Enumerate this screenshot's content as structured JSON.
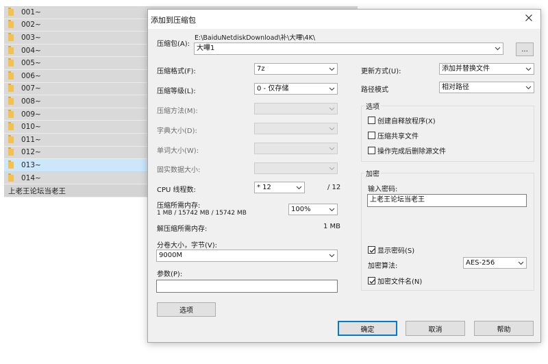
{
  "file_list": {
    "rows": [
      {
        "name": "001~"
      },
      {
        "name": "002~"
      },
      {
        "name": "003~"
      },
      {
        "name": "004~"
      },
      {
        "name": "005~"
      },
      {
        "name": "006~"
      },
      {
        "name": "007~"
      },
      {
        "name": "008~"
      },
      {
        "name": "009~"
      },
      {
        "name": "010~"
      },
      {
        "name": "011~"
      },
      {
        "name": "012~"
      },
      {
        "name": "013~"
      },
      {
        "name": "014~"
      }
    ],
    "selected_row": "013~",
    "extra_row": "上老王论坛当老王"
  },
  "dialog": {
    "title": "添加到压缩包",
    "close_icon": "close-icon",
    "archive": {
      "label": "压缩包(A):",
      "path": "E:\\BaiduNetdiskDownload\\补\\大嗶\\4K\\",
      "name_value": "大嗶1",
      "browse_label": "..."
    },
    "left": {
      "format_label": "压缩格式(F):",
      "format_value": "7z",
      "level_label": "压缩等级(L):",
      "level_value": "0 - 仅存储",
      "method_label": "压缩方法(M):",
      "dict_label": "字典大小(D):",
      "word_label": "单词大小(W):",
      "solid_label": "固实数据大小:",
      "cpu_label": "CPU 线程数:",
      "cpu_value": "* 12",
      "cpu_total": "/ 12",
      "mem_label": "压缩所需内存:",
      "mem_detail": "1 MB / 15742 MB / 15742 MB",
      "mem_percent": "100%",
      "decomp_label": "解压缩所需内存:",
      "decomp_value": "1 MB",
      "volume_label": "分卷大小，字节(V):",
      "volume_value": "9000M",
      "params_label": "参数(P):",
      "params_value": "",
      "options_button": "选项"
    },
    "right": {
      "update_label": "更新方式(U):",
      "update_value": "添加并替换文件",
      "path_label": "路径模式",
      "path_value": "相对路径",
      "options_group": "选项",
      "opt_sfx": "创建自释放程序(X)",
      "opt_shared": "压缩共享文件",
      "opt_delete": "操作完成后删除源文件",
      "encrypt_group": "加密",
      "password_label": "输入密码:",
      "password_value": "上老王论坛当老王",
      "show_password": "显示密码(S)",
      "method_label": "加密算法:",
      "method_value": "AES-256",
      "encrypt_names": "加密文件名(N)"
    },
    "checkbox_states": {
      "sfx": false,
      "shared": false,
      "delete": false,
      "show_password": true,
      "encrypt_names": true
    },
    "footer": {
      "ok": "确定",
      "cancel": "取消",
      "help": "帮助"
    },
    "colors": {
      "accent": "#0078d7",
      "selected_row": "#cce6fa",
      "dialog_bg": "#f0f0f0"
    }
  }
}
